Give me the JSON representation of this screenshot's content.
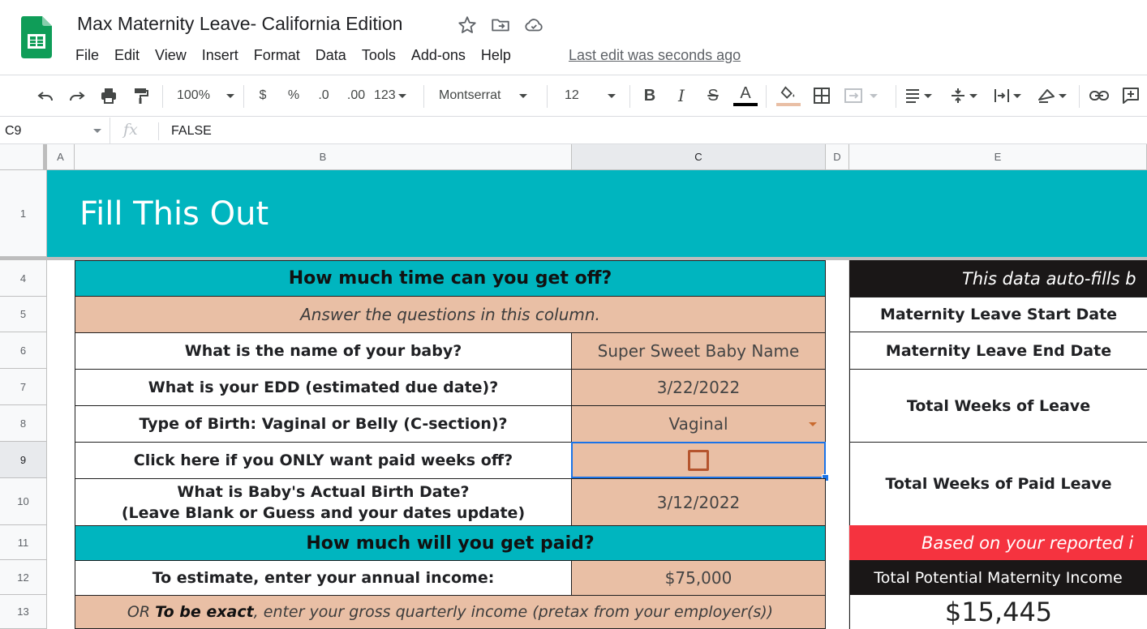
{
  "app": {
    "doc_title": "Max Maternity Leave- California Edition",
    "menu": [
      "File",
      "Edit",
      "View",
      "Insert",
      "Format",
      "Data",
      "Tools",
      "Add-ons",
      "Help"
    ],
    "last_edit": "Last edit was seconds ago"
  },
  "toolbar": {
    "zoom": "100%",
    "currency": "$",
    "percent": "%",
    "decrease_decimal": ".0",
    "increase_decimal": ".00",
    "more_formats": "123",
    "font": "Montserrat",
    "font_size": "12",
    "bold": "B",
    "italic": "I",
    "strikethrough": "S",
    "text_color_letter": "A"
  },
  "formula_bar": {
    "cell_ref": "C9",
    "fx": "fx",
    "value": "FALSE"
  },
  "columns": [
    "A",
    "B",
    "C",
    "D",
    "E"
  ],
  "rows": [
    "1",
    "4",
    "5",
    "6",
    "7",
    "8",
    "9",
    "10",
    "11",
    "12",
    "13"
  ],
  "sheet": {
    "banner_title": "Fill This Out",
    "section1_header": "How much time can you get off?",
    "instruction": "Answer the questions in this column.",
    "q_baby_name": "What is the name of your baby?",
    "a_baby_name": "Super Sweet Baby Name",
    "q_edd": "What is your EDD (estimated due date)?",
    "a_edd": "3/22/2022",
    "q_birth_type": "Type of Birth: Vaginal or Belly (C-section)?",
    "a_birth_type": "Vaginal",
    "q_paid_only": "Click here if you ONLY want paid weeks off?",
    "a_paid_only_checked": false,
    "q_actual_birth_line1": "What is Baby's Actual Birth Date?",
    "q_actual_birth_line2": "(Leave Blank or Guess and your dates update)",
    "a_actual_birth": "3/12/2022",
    "section2_header": "How much will you get paid?",
    "q_income": "To estimate, enter your annual income:",
    "a_income": "$75,000",
    "q_exact_prefix": "OR ",
    "q_exact_bold": "To be exact",
    "q_exact_suffix": ", enter your gross quarterly income (pretax from your employer(s))",
    "autofill_note": "This data auto-fills b",
    "start_date_label": "Maternity Leave Start Date",
    "end_date_label": "Maternity Leave End Date",
    "total_weeks_label": "Total Weeks of Leave",
    "paid_weeks_label": "Total Weeks of Paid Leave",
    "income_note": "Based on your reported i",
    "potential_income_label": "Total Potential Maternity Income",
    "potential_income_value": "$15,445"
  },
  "colors": {
    "teal": "#00b5bf",
    "peach": "#e9bfa5",
    "black": "#1a1717",
    "red": "#f5333f",
    "selection": "#1a73e8",
    "checkbox": "#b5552e",
    "sheets_green": "#0f9d58"
  }
}
